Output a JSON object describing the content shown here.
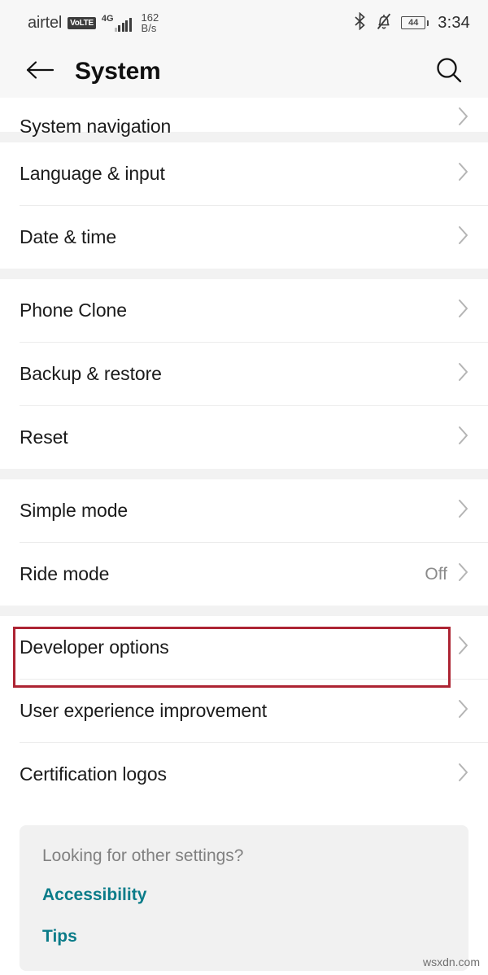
{
  "status_bar": {
    "carrier": "airtel",
    "volte_badge": "VoLTE",
    "network_type": "4G",
    "data_speed_value": "162",
    "data_speed_unit": "B/s",
    "bluetooth_icon": "bluetooth-icon",
    "silent_icon": "bell-muted-icon",
    "battery_level": "44",
    "time": "3:34"
  },
  "appbar": {
    "back_icon": "back-arrow-icon",
    "title": "System",
    "search_icon": "search-icon"
  },
  "groups": [
    {
      "id": "group-navigation",
      "clipped_first": true,
      "items": [
        {
          "label": "System navigation",
          "value": "",
          "chevron": true
        }
      ]
    },
    {
      "id": "group-language",
      "clipped_first": false,
      "items": [
        {
          "label": "Language & input",
          "value": "",
          "chevron": true
        },
        {
          "label": "Date & time",
          "value": "",
          "chevron": true
        }
      ]
    },
    {
      "id": "group-transfer",
      "clipped_first": false,
      "items": [
        {
          "label": "Phone Clone",
          "value": "",
          "chevron": true
        },
        {
          "label": "Backup & restore",
          "value": "",
          "chevron": true
        },
        {
          "label": "Reset",
          "value": "",
          "chevron": true
        }
      ]
    },
    {
      "id": "group-modes",
      "clipped_first": false,
      "items": [
        {
          "label": "Simple mode",
          "value": "",
          "chevron": true
        },
        {
          "label": "Ride mode",
          "value": "Off",
          "chevron": true
        }
      ]
    },
    {
      "id": "group-developer",
      "clipped_first": false,
      "items": [
        {
          "label": "Developer options",
          "value": "",
          "chevron": true
        },
        {
          "label": "User experience improvement",
          "value": "",
          "chevron": true
        },
        {
          "label": "Certification logos",
          "value": "",
          "chevron": true
        }
      ]
    }
  ],
  "highlight": {
    "target_label": "Developer options",
    "color": "#ad2433"
  },
  "footer": {
    "title": "Looking for other settings?",
    "links": [
      {
        "label": "Accessibility"
      },
      {
        "label": "Tips"
      }
    ],
    "link_color": "#0b7c89"
  },
  "watermark": "wsxdn.com"
}
